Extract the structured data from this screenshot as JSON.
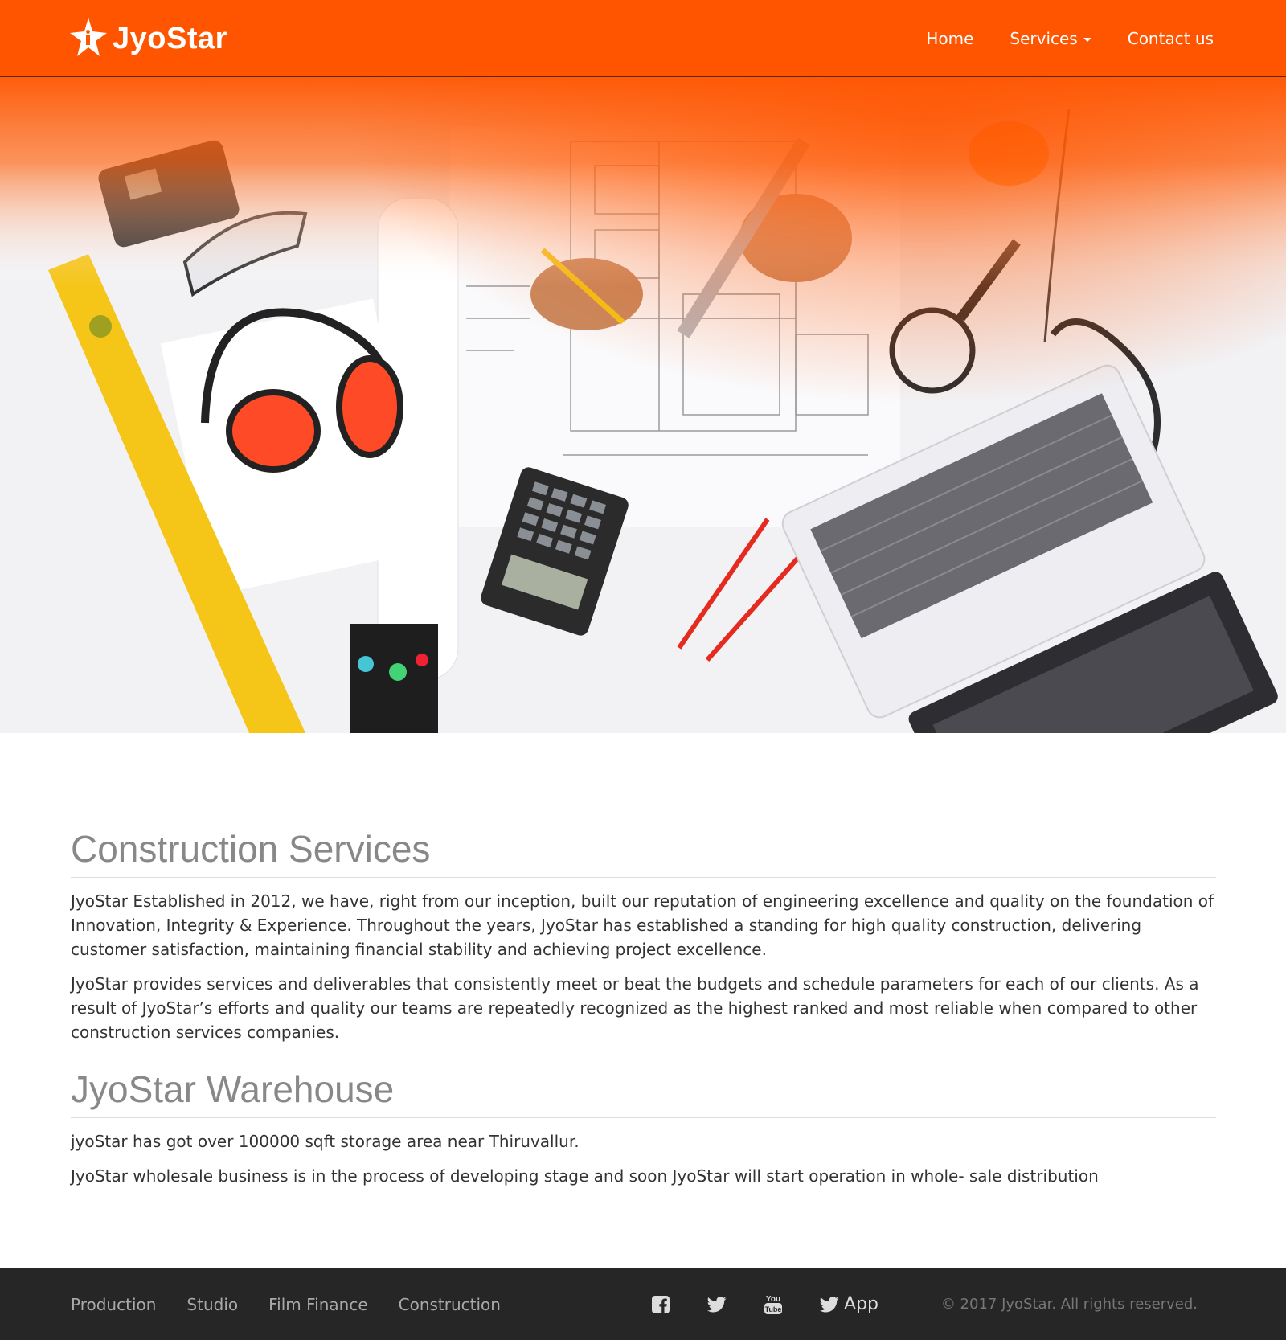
{
  "brand": {
    "name": "JyoStar"
  },
  "nav": {
    "home": "Home",
    "services": "Services",
    "contact": "Contact us"
  },
  "hero": {
    "image_alt": "construction tools, blueprints, hard hat, ear defenders and laptop on a desk"
  },
  "sections": [
    {
      "title": "Construction Services",
      "paragraphs": [
        "JyoStar Established in 2012, we have, right from our inception, built our reputation of engineering excellence and quality on the foundation of Innovation, Integrity & Experience. Throughout the years, JyoStar has established a standing for high quality construction, delivering customer satisfaction, maintaining financial stability and achieving project excellence.",
        "JyoStar provides services and deliverables that consistently meet or beat the budgets and schedule parameters for each of our clients. As a result of JyoStar’s efforts and quality our teams are repeatedly recognized as the highest ranked and most reliable when compared to other construction services companies."
      ]
    },
    {
      "title": "JyoStar Warehouse",
      "paragraphs": [
        "jyoStar has got over 100000 sqft storage area near Thiruvallur.",
        "JyoStar wholesale business is in the process of developing stage and soon JyoStar will start operation in whole- sale distribution"
      ]
    }
  ],
  "footer": {
    "links": [
      "Production",
      "Studio",
      "Film Finance",
      "Construction"
    ],
    "social_icons": [
      "facebook-icon",
      "twitter-icon",
      "youtube-icon"
    ],
    "app_label": "App",
    "copyright": "© 2017 JyoStar. All rights reserved."
  },
  "colors": {
    "accent": "#ff5500",
    "footer_bg": "#262626",
    "heading": "#888888",
    "text": "#333333"
  }
}
